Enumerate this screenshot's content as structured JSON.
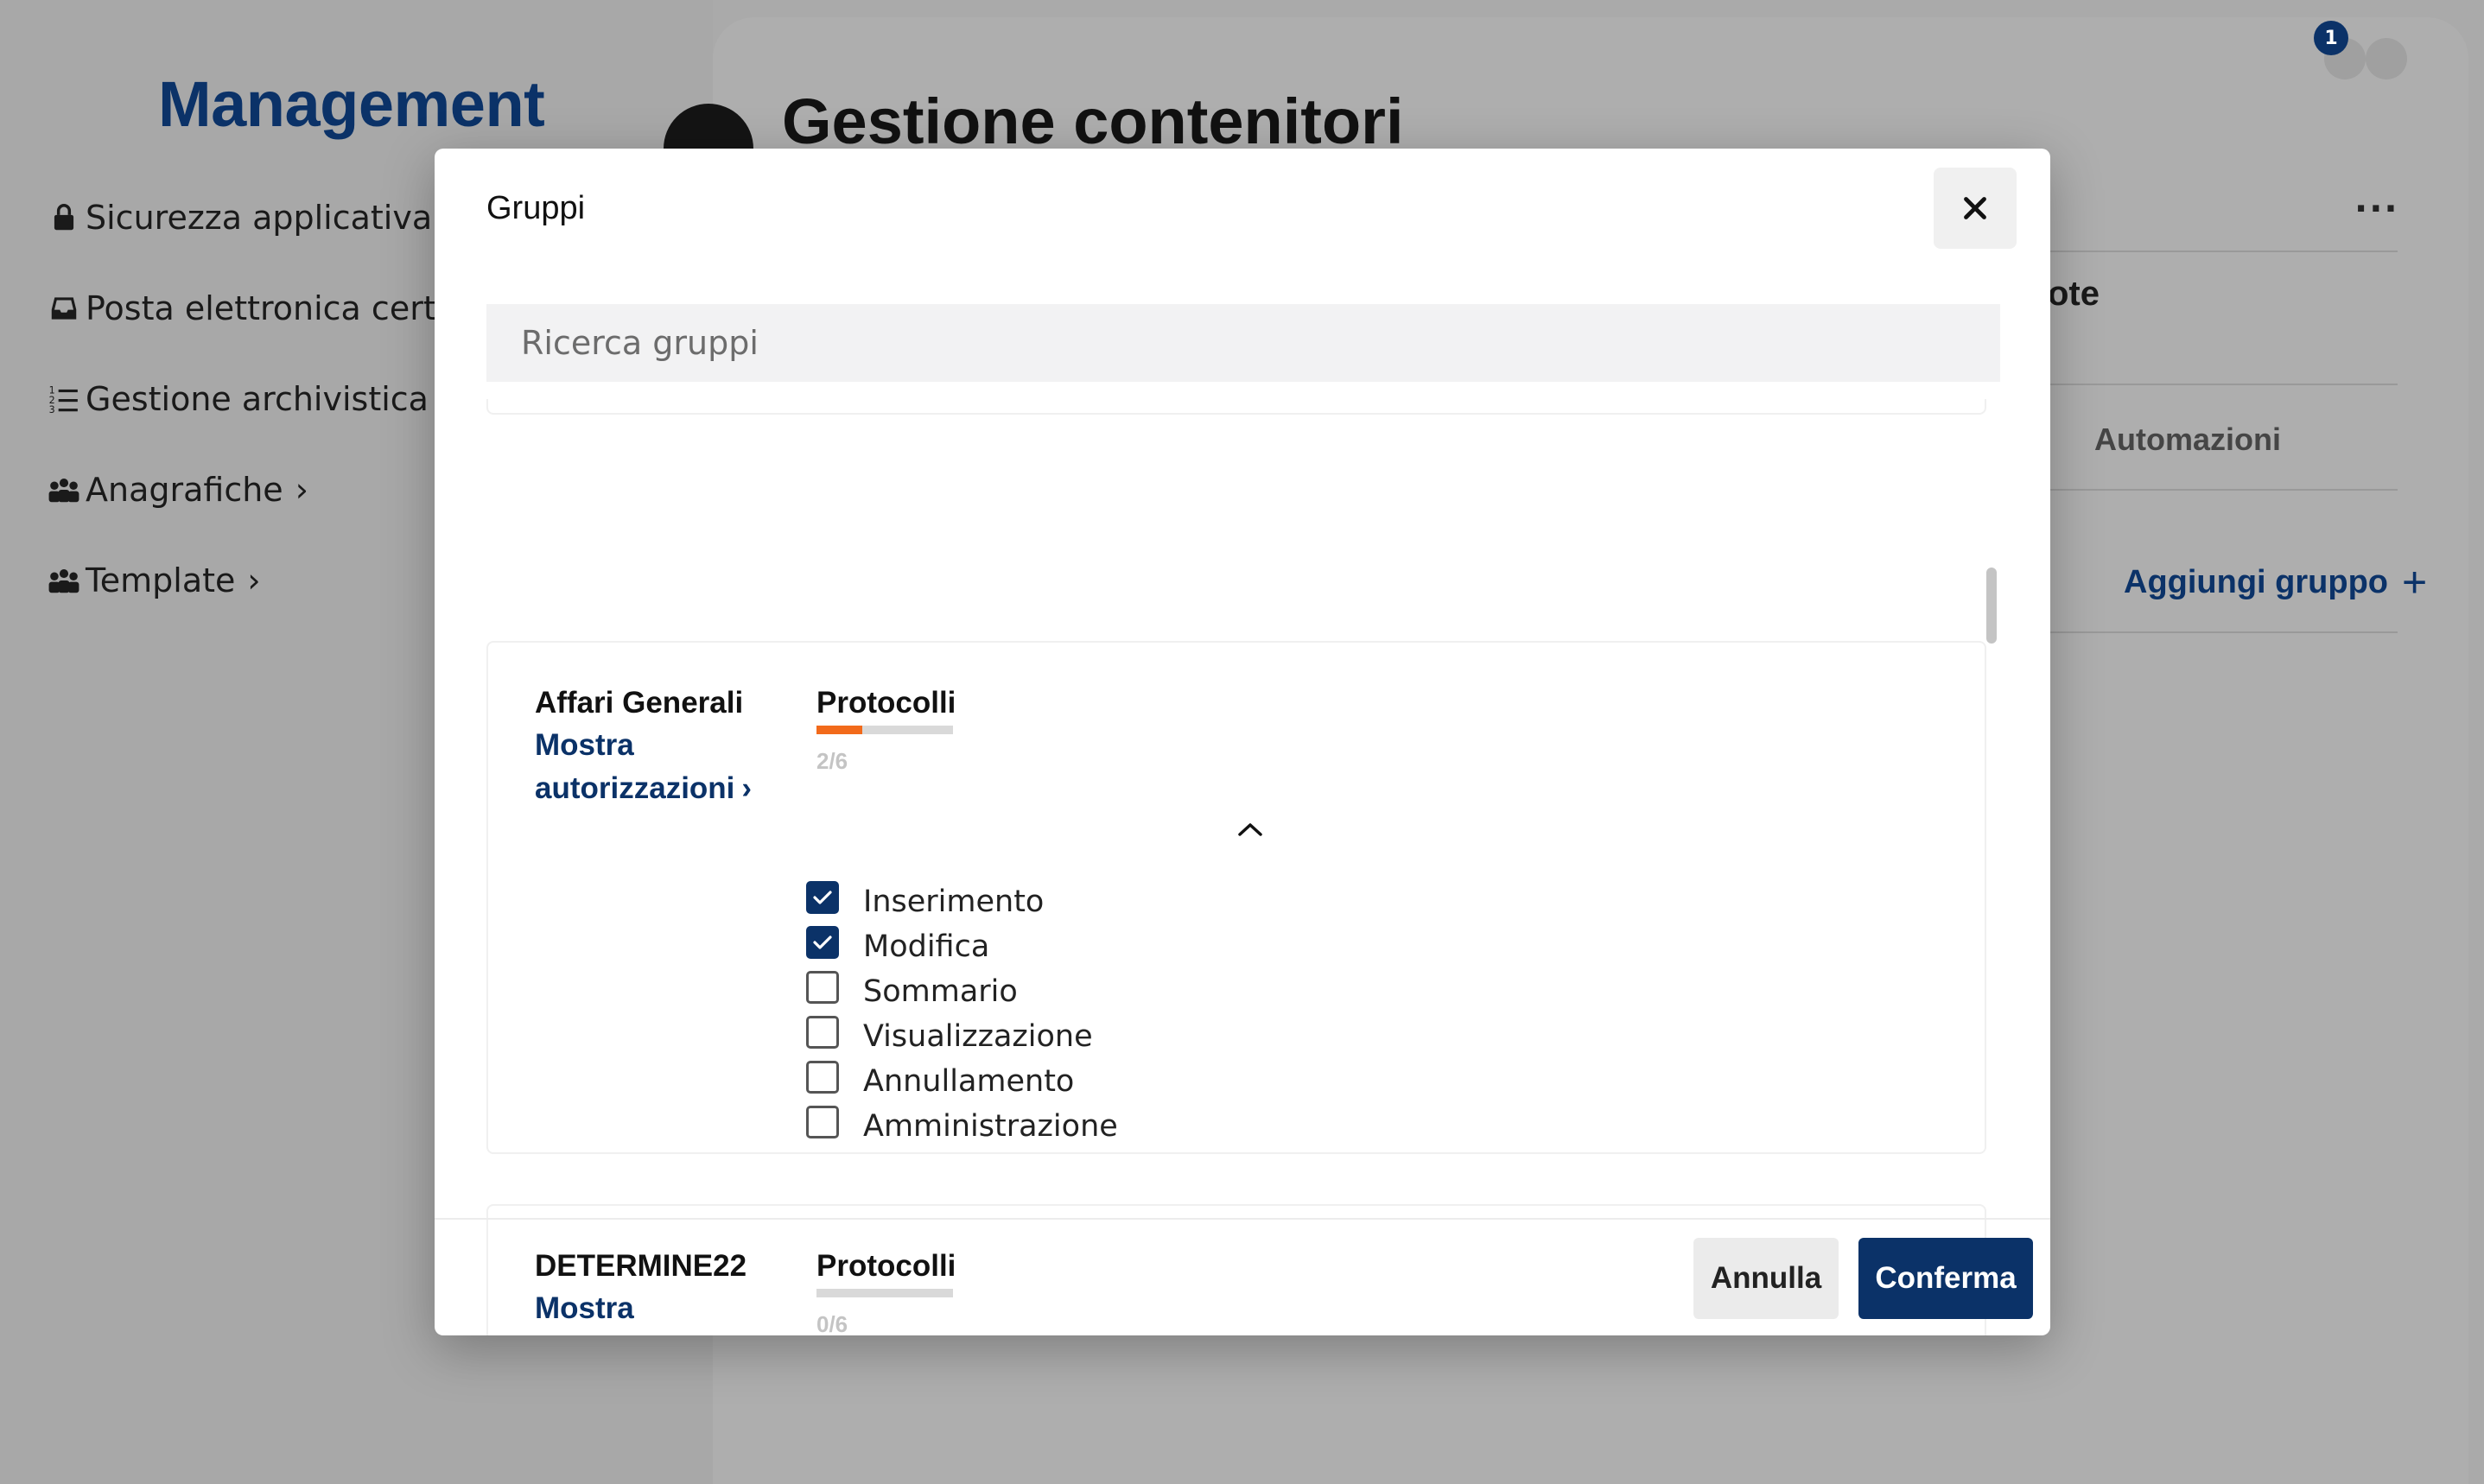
{
  "app": {
    "brand": "Management"
  },
  "sidebar": {
    "items": [
      {
        "label": "Sicurezza applicativa",
        "icon": "lock-icon"
      },
      {
        "label": "Posta elettronica certificata",
        "icon": "inbox-icon"
      },
      {
        "label": "Gestione archivistica",
        "icon": "numbered-list-icon"
      },
      {
        "label": "Anagrafiche",
        "icon": "people-icon"
      },
      {
        "label": "Template",
        "icon": "people-icon"
      }
    ]
  },
  "page": {
    "title": "Gestione contenitori",
    "notification_count": "1",
    "partial_label": "ote",
    "tab_automazioni": "Automazioni",
    "add_group": "Aggiungi gruppo"
  },
  "modal": {
    "title": "Gruppi",
    "search_placeholder": "Ricerca gruppi",
    "groups": [
      {
        "name": "Affari Generali",
        "show_auth": "Mostra autorizzazioni",
        "category": "Protocolli",
        "progress": 0.3333,
        "count": "2/6",
        "permissions": [
          {
            "label": "Inserimento",
            "checked": true
          },
          {
            "label": "Modifica",
            "checked": true
          },
          {
            "label": "Sommario",
            "checked": false
          },
          {
            "label": "Visualizzazione",
            "checked": false
          },
          {
            "label": "Annullamento",
            "checked": false
          },
          {
            "label": "Amministrazione",
            "checked": false
          }
        ]
      },
      {
        "name": "DETERMINE22",
        "show_auth": "Mostra autorizzazioni",
        "category": "Protocolli",
        "progress": 0,
        "count": "0/6"
      }
    ],
    "cancel_label": "Annulla",
    "confirm_label": "Conferma"
  },
  "colors": {
    "brand_navy": "#0b3268",
    "progress_orange": "#f26a1b",
    "overlay_gray": "#aaaaaa"
  }
}
